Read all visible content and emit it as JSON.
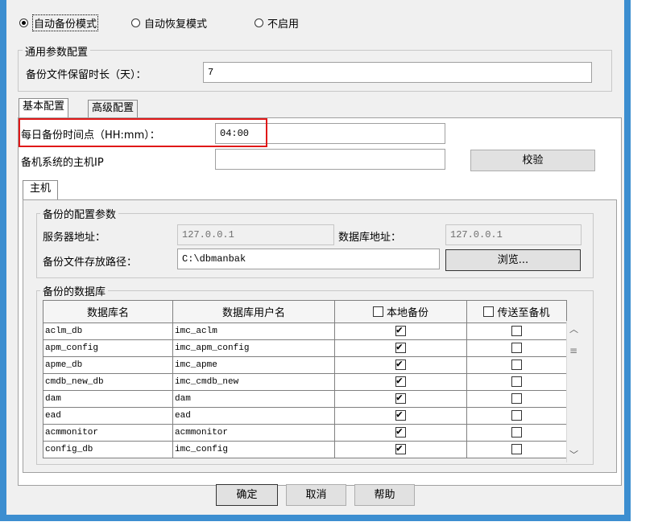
{
  "mode": {
    "options": [
      "自动备份模式",
      "自动恢复模式",
      "不启用"
    ],
    "selected_index": 0
  },
  "general": {
    "title": "通用参数配置",
    "retention_label": "备份文件保留时长（天）：",
    "retention_value": "7"
  },
  "tabs": [
    "基本配置",
    "高级配置"
  ],
  "active_tab": 0,
  "basic": {
    "time_label": "每日备份时间点（HH:mm）：",
    "time_value": "04:00",
    "backup_ip_label": "备机系统的主机IP",
    "backup_ip_value": "",
    "verify_button": "校验"
  },
  "inner_tab": "主机",
  "backup_config": {
    "title": "备份的配置参数",
    "server_addr_label": "服务器地址：",
    "server_addr_value": "127.0.0.1",
    "db_addr_label": "数据库地址：",
    "db_addr_value": "127.0.0.1",
    "path_label": "备份文件存放路径：",
    "path_value": "C:\\dbmanbak",
    "browse_button": "浏览..."
  },
  "databases": {
    "title": "备份的数据库",
    "columns": [
      "数据库名",
      "数据库用户名",
      "本地备份",
      "传送至备机"
    ],
    "rows": [
      {
        "name": "aclm_db",
        "user": "imc_aclm",
        "local": true,
        "remote": false
      },
      {
        "name": "apm_config",
        "user": "imc_apm_config",
        "local": true,
        "remote": false
      },
      {
        "name": "apme_db",
        "user": "imc_apme",
        "local": true,
        "remote": false
      },
      {
        "name": "cmdb_new_db",
        "user": "imc_cmdb_new",
        "local": true,
        "remote": false
      },
      {
        "name": "dam",
        "user": "dam",
        "local": true,
        "remote": false
      },
      {
        "name": "ead",
        "user": "ead",
        "local": true,
        "remote": false
      },
      {
        "name": "acmmonitor",
        "user": "acmmonitor",
        "local": true,
        "remote": false
      },
      {
        "name": "config_db",
        "user": "imc_config",
        "local": true,
        "remote": false
      }
    ]
  },
  "footer": {
    "ok": "确定",
    "cancel": "取消",
    "help": "帮助"
  },
  "colors": {
    "window_border": "#3c8ed0",
    "highlight": "#e01818",
    "dialog_bg": "#f0f0f0"
  }
}
